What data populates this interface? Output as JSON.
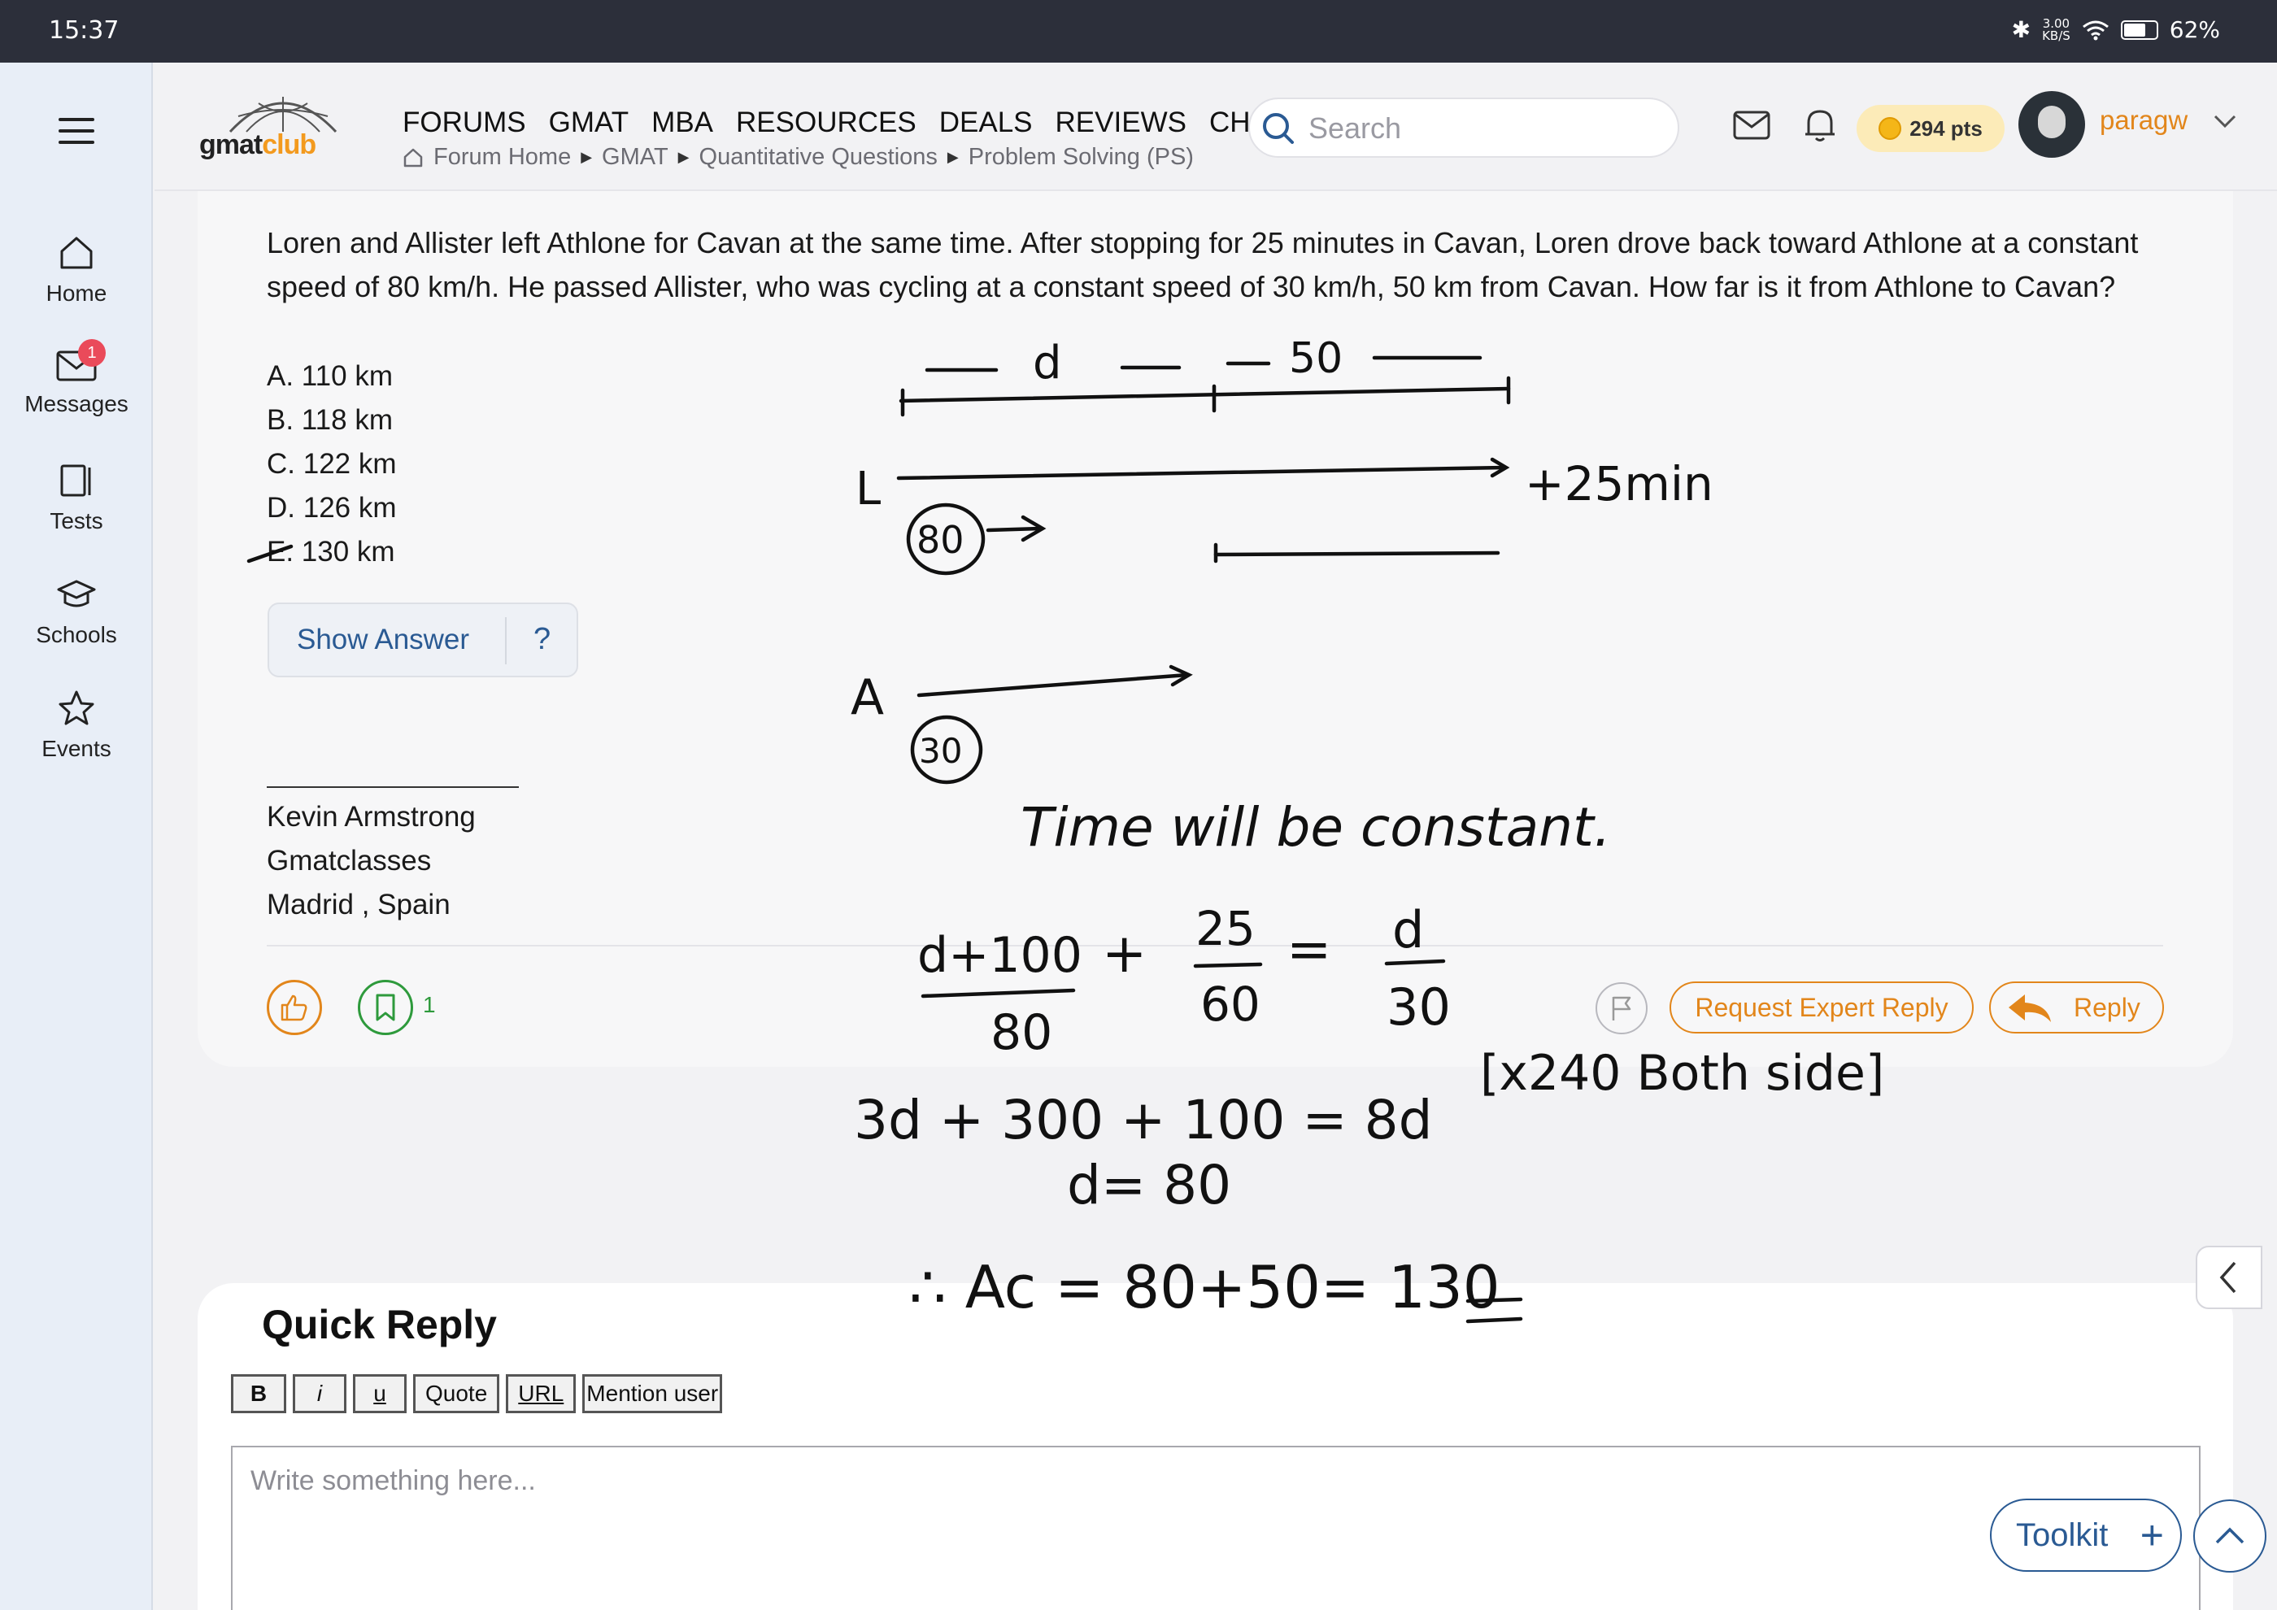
{
  "status_bar": {
    "time": "15:37",
    "net_speed_top": "3.00",
    "net_speed_bottom": "KB/S",
    "battery": "62%"
  },
  "sidebar": {
    "items": [
      {
        "label": "Home",
        "icon": "home-icon"
      },
      {
        "label": "Messages",
        "icon": "envelope-icon",
        "badge": "1"
      },
      {
        "label": "Tests",
        "icon": "test-icon"
      },
      {
        "label": "Schools",
        "icon": "graduation-cap-icon"
      },
      {
        "label": "Events",
        "icon": "star-icon"
      }
    ]
  },
  "header": {
    "logo_part1": "gmat",
    "logo_part2": "club",
    "nav": [
      "FORUMS",
      "GMAT",
      "MBA",
      "RESOURCES",
      "DEALS",
      "REVIEWS",
      "CHAT"
    ],
    "breadcrumb": [
      "Forum Home",
      "GMAT",
      "Quantitative Questions",
      "Problem Solving (PS)"
    ],
    "search_placeholder": "Search",
    "points": "294 pts",
    "username": "paragw"
  },
  "post": {
    "question": "Loren and Allister left Athlone for Cavan at the same time. After stopping for 25 minutes in Cavan, Loren drove back toward Athlone at a constant speed of 80 km/h. He passed Allister, who was cycling at a constant speed of 30 km/h, 50 km from Cavan. How far is it from Athlone to Cavan?",
    "options": [
      "A. 110 km",
      "B. 118 km",
      "C. 122 km",
      "D. 126 km",
      "E. 130 km"
    ],
    "show_answer_label": "Show Answer",
    "help_label": "?",
    "signature": [
      "Kevin Armstrong",
      "Gmatclasses",
      "Madrid , Spain"
    ],
    "bookmark_count": "1",
    "request_expert_label": "Request Expert Reply",
    "reply_label": "Reply"
  },
  "annotation": {
    "seg_d": "d",
    "seg_50": "50",
    "label_L": "L",
    "plus_25": "+25min",
    "speed_80": "80",
    "label_A": "A",
    "speed_30": "30",
    "time_note": "Time will be constant.",
    "eq_num1": "d+100",
    "eq_plus": "+",
    "eq_num2": "25",
    "eq_equals": "=",
    "eq_num3": "d",
    "eq_den1": "80",
    "eq_den2": "60",
    "eq_den3": "30",
    "eq_line2": "3d + 300 + 100 = 8d",
    "eq_note": "[x240 Both side]",
    "eq_line3": "d= 80",
    "eq_line4": "∴ Ac = 80+50= 130"
  },
  "quick_reply": {
    "title": "Quick Reply",
    "tools": [
      "B",
      "i",
      "u",
      "Quote",
      "URL",
      "Mention user"
    ],
    "placeholder": "Write something here..."
  },
  "floating": {
    "toolkit_label": "Toolkit",
    "toolkit_plus": "+"
  },
  "colors": {
    "accent_orange": "#e2861b",
    "link_blue": "#2a5a93",
    "bookmark_green": "#2e9a3c",
    "badge_red": "#ea4a5a",
    "status_bar": "#2c2f3a"
  }
}
